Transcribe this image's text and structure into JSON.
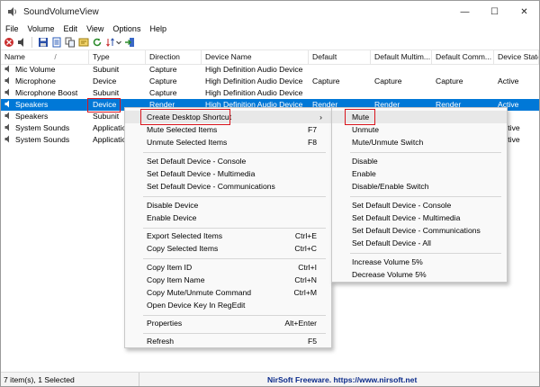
{
  "window": {
    "title": "SoundVolumeView"
  },
  "menubar": [
    "File",
    "Volume",
    "Edit",
    "View",
    "Options",
    "Help"
  ],
  "window_controls": {
    "minimize": "—",
    "maximize": "☐",
    "close": "✕"
  },
  "columns": {
    "name": "Name",
    "sort_indicator": "/",
    "type": "Type",
    "direction": "Direction",
    "device_name": "Device Name",
    "default": "Default",
    "default_multimedia": "Default Multim...",
    "default_communications": "Default Comm...",
    "device_state": "Device State"
  },
  "rows": [
    {
      "name": "Mic Volume",
      "type": "Subunit",
      "direction": "Capture",
      "device_name": "High Definition Audio Device",
      "default": "",
      "default_multimedia": "",
      "default_communications": "",
      "device_state": ""
    },
    {
      "name": "Microphone",
      "type": "Device",
      "direction": "Capture",
      "device_name": "High Definition Audio Device",
      "default": "Capture",
      "default_multimedia": "Capture",
      "default_communications": "Capture",
      "device_state": "Active"
    },
    {
      "name": "Microphone Boost",
      "type": "Subunit",
      "direction": "Capture",
      "device_name": "High Definition Audio Device",
      "default": "",
      "default_multimedia": "",
      "default_communications": "",
      "device_state": ""
    },
    {
      "name": "Speakers",
      "type": "Device",
      "direction": "Render",
      "device_name": "High Definition Audio Device",
      "default": "Render",
      "default_multimedia": "Render",
      "default_communications": "Render",
      "device_state": "Active"
    },
    {
      "name": "Speakers",
      "type": "Subunit",
      "direction": "",
      "device_name": "",
      "default": "",
      "default_multimedia": "",
      "default_communications": "",
      "device_state": ""
    },
    {
      "name": "System Sounds",
      "type": "Applicatio",
      "direction": "",
      "device_name": "",
      "default": "",
      "default_multimedia": "",
      "default_communications": "",
      "device_state": "ctive"
    },
    {
      "name": "System Sounds",
      "type": "Applicatio",
      "direction": "",
      "device_name": "",
      "default": "",
      "default_multimedia": "",
      "default_communications": "",
      "device_state": "ctive"
    }
  ],
  "context_menu": {
    "create_shortcut": "Create Desktop Shortcut",
    "create_shortcut_arrow": "›",
    "mute_selected": "Mute Selected Items",
    "mute_selected_key": "F7",
    "unmute_selected": "Unmute Selected Items",
    "unmute_selected_key": "F8",
    "set_default_console": "Set Default Device - Console",
    "set_default_multimedia": "Set Default Device - Multimedia",
    "set_default_communications": "Set Default Device - Communications",
    "disable_device": "Disable Device",
    "enable_device": "Enable Device",
    "export_selected": "Export Selected Items",
    "export_selected_key": "Ctrl+E",
    "copy_selected": "Copy Selected Items",
    "copy_selected_key": "Ctrl+C",
    "copy_item_id": "Copy Item ID",
    "copy_item_id_key": "Ctrl+I",
    "copy_item_name": "Copy Item Name",
    "copy_item_name_key": "Ctrl+N",
    "copy_mute_cmd": "Copy Mute/Unmute Command",
    "copy_mute_cmd_key": "Ctrl+M",
    "open_regedit": "Open Device Key In RegEdit",
    "properties": "Properties",
    "properties_key": "Alt+Enter",
    "refresh": "Refresh",
    "refresh_key": "F5"
  },
  "submenu": {
    "mute": "Mute",
    "unmute": "Unmute",
    "mute_unmute_switch": "Mute/Unmute Switch",
    "disable": "Disable",
    "enable": "Enable",
    "disable_enable_switch": "Disable/Enable Switch",
    "set_console": "Set Default Device - Console",
    "set_multimedia": "Set Default Device - Multimedia",
    "set_communications": "Set Default Device - Communications",
    "set_all": "Set Default Device - All",
    "increase_volume": "Increase Volume 5%",
    "decrease_volume": "Decrease Volume 5%"
  },
  "statusbar": {
    "count": "7 item(s), 1 Selected",
    "credit": "NirSoft Freeware. https://www.nirsoft.net"
  },
  "colors": {
    "selection": "#0078d7",
    "highlight_box": "#d9141c"
  }
}
